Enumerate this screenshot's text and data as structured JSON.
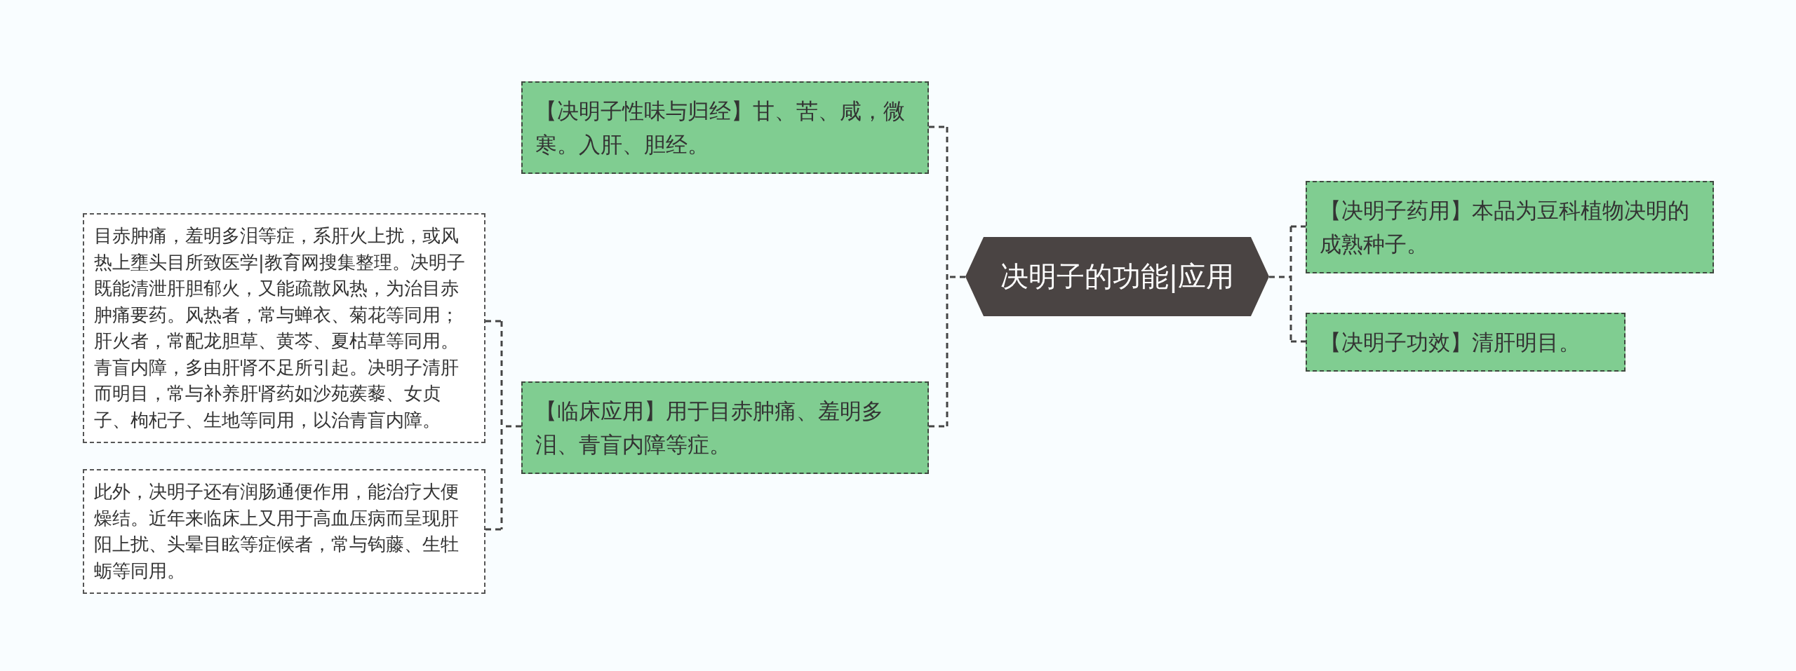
{
  "root": {
    "title": "决明子的功能|应用"
  },
  "left": [
    {
      "text": "【决明子性味与归经】甘、苦、咸，微寒。入肝、胆经。"
    },
    {
      "text": "【临床应用】用于目赤肿痛、羞明多泪、青盲内障等症。",
      "children": [
        {
          "text": "目赤肿痛，羞明多泪等症，系肝火上扰，或风热上壅头目所致医学|教育网搜集整理。决明子既能清泄肝胆郁火，又能疏散风热，为治目赤肿痛要药。风热者，常与蝉衣、菊花等同用；肝火者，常配龙胆草、黄芩、夏枯草等同用。青盲内障，多由肝肾不足所引起。决明子清肝而明目，常与补养肝肾药如沙苑蒺藜、女贞子、枸杞子、生地等同用，以治青盲内障。"
        },
        {
          "text": "此外，决明子还有润肠通便作用，能治疗大便燥结。近年来临床上又用于高血压病而呈现肝阳上扰、头晕目眩等症候者，常与钩藤、生牡蛎等同用。"
        }
      ]
    }
  ],
  "right": [
    {
      "text": "【决明子药用】本品为豆科植物决明的成熟种子。"
    },
    {
      "text": "【决明子功效】清肝明目。"
    }
  ]
}
